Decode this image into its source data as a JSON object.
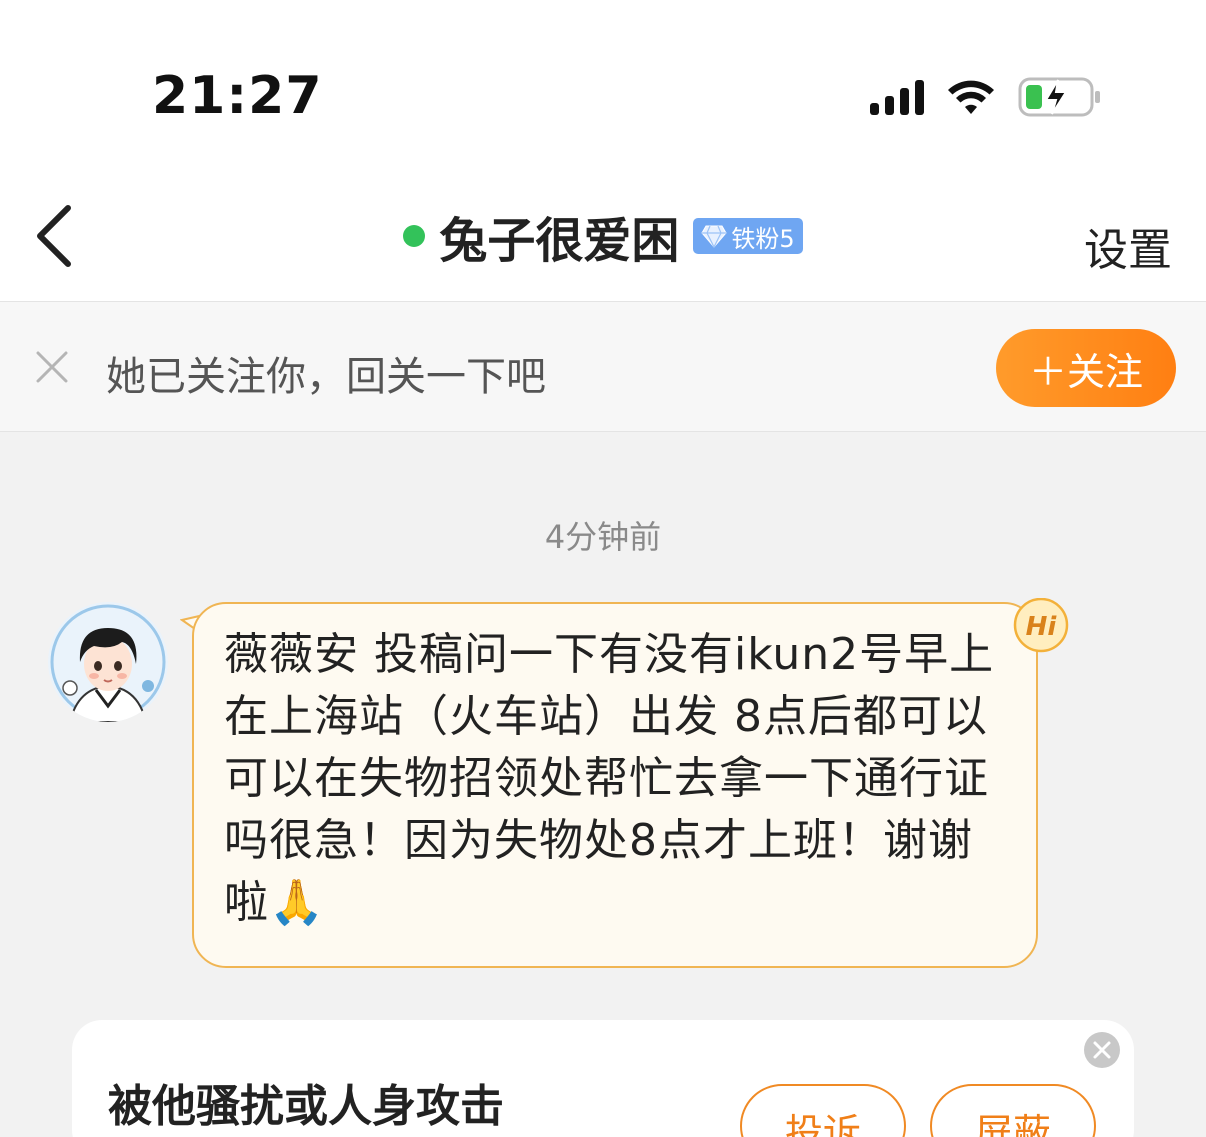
{
  "status_bar": {
    "time": "21:27",
    "icons": [
      "signal-icon",
      "wifi-icon",
      "battery-charging-icon"
    ]
  },
  "nav": {
    "title": "兔子很爱困",
    "badge": "铁粉5",
    "settings_label": "设置",
    "online_color": "#33c25a"
  },
  "follow_banner": {
    "text": "她已关注你，回关一下吧",
    "button_label": "＋关注"
  },
  "chat": {
    "timestamp": "4分钟前",
    "messages": [
      {
        "sender": "other",
        "text": "薇薇安 投稿问一下有没有ikun2号早上在上海站（火车站）出发 8点后都可以 可以在失物招领处帮忙去拿一下通行证吗很急！因为失物处8点才上班！谢谢啦🙏",
        "badge": "Hi"
      }
    ]
  },
  "report_card": {
    "title": "被他骚扰或人身攻击",
    "complain_label": "投诉",
    "block_label": "屏蔽"
  },
  "colors": {
    "accent": "#ff8a1f",
    "bubble_bg": "#fefaf1",
    "bubble_border": "#f0b553",
    "badge_blue": "#6fa6f2"
  }
}
